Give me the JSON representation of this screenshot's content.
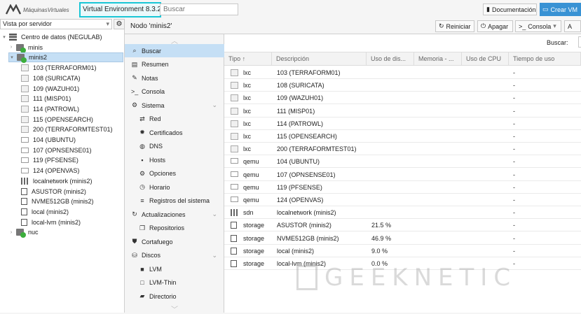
{
  "topbar": {
    "logo_text": "MáquinasVirtuales",
    "version": "Virtual Environment 8.3.2",
    "search_placeholder": "Buscar",
    "doc_label": "Documentación",
    "create_vm_label": "Crear VM"
  },
  "tree": {
    "view_label": "Vista por servidor",
    "items": [
      {
        "label": "Centro de datos (NEGULAB)",
        "icon": "datacenter-icon"
      },
      {
        "label": "minis",
        "icon": "node-icon"
      },
      {
        "label": "minis2",
        "icon": "node-icon"
      },
      {
        "label": "103 (TERRAFORM01)",
        "icon": "container-icon"
      },
      {
        "label": "108 (SURICATA)",
        "icon": "container-icon"
      },
      {
        "label": "109 (WAZUH01)",
        "icon": "container-icon"
      },
      {
        "label": "111 (MISP01)",
        "icon": "container-icon"
      },
      {
        "label": "114 (PATROWL)",
        "icon": "container-icon"
      },
      {
        "label": "115 (OPENSEARCH)",
        "icon": "container-icon"
      },
      {
        "label": "200 (TERRAFORMTEST01)",
        "icon": "container-icon"
      },
      {
        "label": "104 (UBUNTU)",
        "icon": "vm-icon"
      },
      {
        "label": "107 (OPNSENSE01)",
        "icon": "vm-icon"
      },
      {
        "label": "119 (PFSENSE)",
        "icon": "vm-icon"
      },
      {
        "label": "124 (OPENVAS)",
        "icon": "vm-icon"
      },
      {
        "label": "localnetwork (minis2)",
        "icon": "network-icon"
      },
      {
        "label": "ASUSTOR (minis2)",
        "icon": "storage-icon"
      },
      {
        "label": "NVME512GB (minis2)",
        "icon": "storage-icon"
      },
      {
        "label": "local (minis2)",
        "icon": "storage-icon"
      },
      {
        "label": "local-lvm (minis2)",
        "icon": "storage-icon"
      },
      {
        "label": "nuc",
        "icon": "node-icon"
      }
    ]
  },
  "header": {
    "node_title": "Nodo 'minis2'",
    "restart_label": "Reiniciar",
    "shutdown_label": "Apagar",
    "console_label": "Consola",
    "more_label": "A"
  },
  "menu": {
    "items": [
      {
        "label": "Buscar",
        "icon": "search-icon"
      },
      {
        "label": "Resumen",
        "icon": "summary-icon"
      },
      {
        "label": "Notas",
        "icon": "notes-icon"
      },
      {
        "label": "Consola",
        "icon": "terminal-icon"
      },
      {
        "label": "Sistema",
        "icon": "gear-icon"
      },
      {
        "label": "Red",
        "icon": "network-icon"
      },
      {
        "label": "Certificados",
        "icon": "certificate-icon"
      },
      {
        "label": "DNS",
        "icon": "globe-icon"
      },
      {
        "label": "Hosts",
        "icon": "hosts-icon"
      },
      {
        "label": "Opciones",
        "icon": "gear-icon"
      },
      {
        "label": "Horario",
        "icon": "clock-icon"
      },
      {
        "label": "Registros del sistema",
        "icon": "list-icon"
      },
      {
        "label": "Actualizaciones",
        "icon": "refresh-icon"
      },
      {
        "label": "Repositorios",
        "icon": "files-icon"
      },
      {
        "label": "Cortafuego",
        "icon": "shield-icon"
      },
      {
        "label": "Discos",
        "icon": "database-icon"
      },
      {
        "label": "LVM",
        "icon": "square-icon"
      },
      {
        "label": "LVM-Thin",
        "icon": "square-outline-icon"
      },
      {
        "label": "Directorio",
        "icon": "folder-icon"
      }
    ]
  },
  "content": {
    "search_label": "Buscar:",
    "columns": [
      "Tipo ↑",
      "Descripción",
      "Uso de dis...",
      "Memoria - ...",
      "Uso de CPU",
      "Tiempo de uso"
    ],
    "rows": [
      {
        "type": "lxc",
        "desc": "103 (TERRAFORM01)",
        "disk": "",
        "uptime": "-"
      },
      {
        "type": "lxc",
        "desc": "108 (SURICATA)",
        "disk": "",
        "uptime": "-"
      },
      {
        "type": "lxc",
        "desc": "109 (WAZUH01)",
        "disk": "",
        "uptime": "-"
      },
      {
        "type": "lxc",
        "desc": "111 (MISP01)",
        "disk": "",
        "uptime": "-"
      },
      {
        "type": "lxc",
        "desc": "114 (PATROWL)",
        "disk": "",
        "uptime": "-"
      },
      {
        "type": "lxc",
        "desc": "115 (OPENSEARCH)",
        "disk": "",
        "uptime": "-"
      },
      {
        "type": "lxc",
        "desc": "200 (TERRAFORMTEST01)",
        "disk": "",
        "uptime": "-"
      },
      {
        "type": "qemu",
        "desc": "104 (UBUNTU)",
        "disk": "",
        "uptime": "-"
      },
      {
        "type": "qemu",
        "desc": "107 (OPNSENSE01)",
        "disk": "",
        "uptime": "-"
      },
      {
        "type": "qemu",
        "desc": "119 (PFSENSE)",
        "disk": "",
        "uptime": "-"
      },
      {
        "type": "qemu",
        "desc": "124 (OPENVAS)",
        "disk": "",
        "uptime": "-"
      },
      {
        "type": "sdn",
        "desc": "localnetwork (minis2)",
        "disk": "",
        "uptime": "-"
      },
      {
        "type": "storage",
        "desc": "ASUSTOR (minis2)",
        "disk": "21.5 %",
        "uptime": "-"
      },
      {
        "type": "storage",
        "desc": "NVME512GB (minis2)",
        "disk": "46.9 %",
        "uptime": "-"
      },
      {
        "type": "storage",
        "desc": "local (minis2)",
        "disk": "9.0 %",
        "uptime": "-"
      },
      {
        "type": "storage",
        "desc": "local-lvm (minis2)",
        "disk": "0.0 %",
        "uptime": "-"
      }
    ]
  },
  "watermark": {
    "text": "GEEKNETIC"
  },
  "colors": {
    "accent": "#3892d4",
    "highlight": "#19c6d6",
    "selection": "#c5dff5",
    "running": "#3cae3c"
  }
}
